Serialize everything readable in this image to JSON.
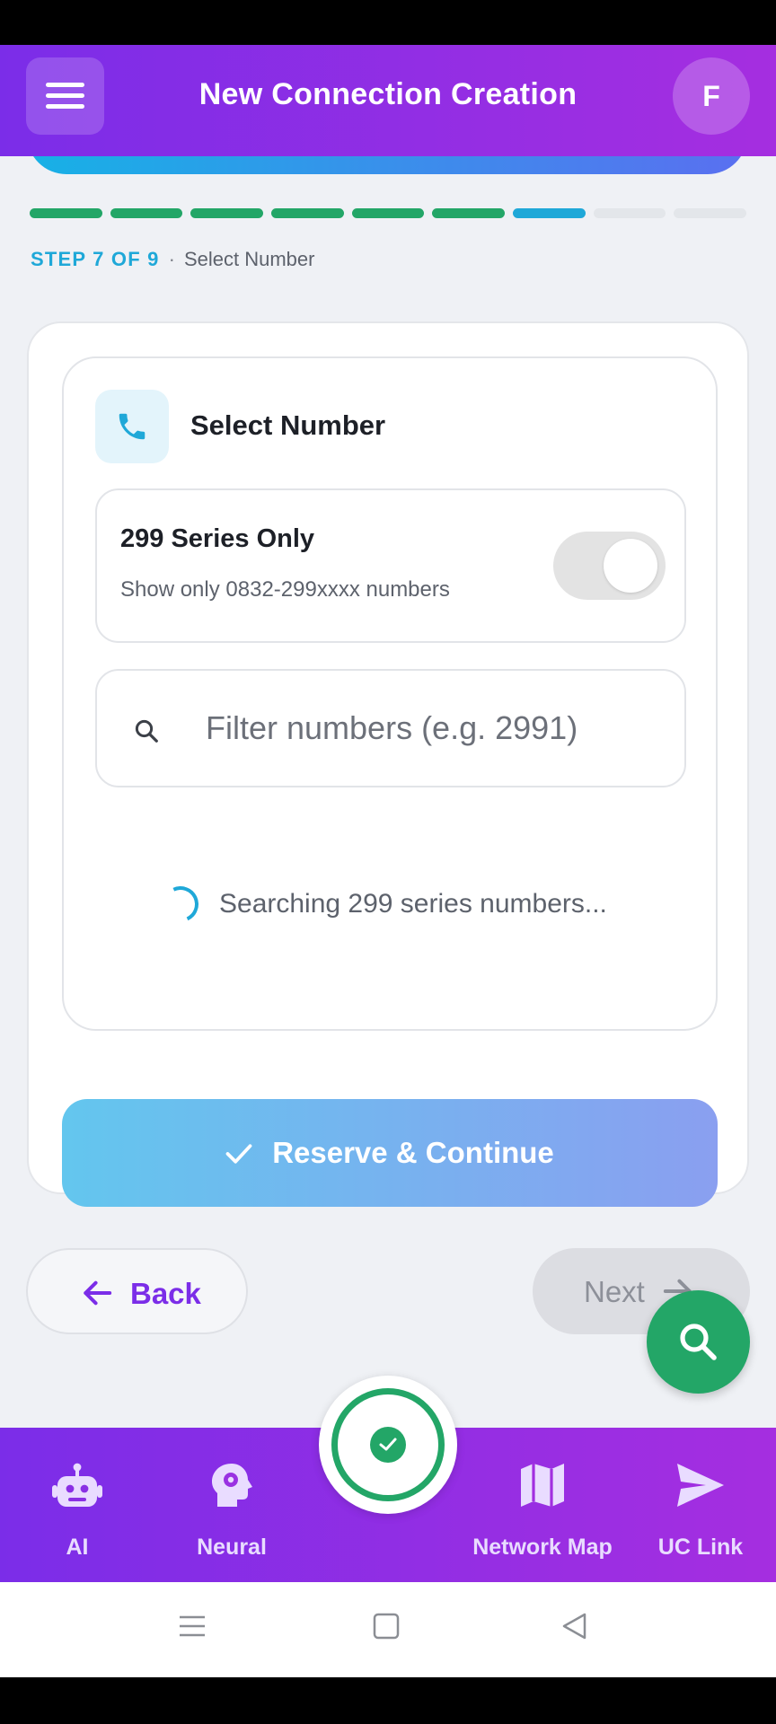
{
  "header": {
    "title": "New Connection Creation",
    "avatar_initial": "F",
    "color": "#7b2de8"
  },
  "progress": {
    "current_step": 7,
    "total_steps": 9,
    "step_label": "STEP 7 OF 9",
    "separator": "·",
    "step_name": "Select Number"
  },
  "card": {
    "title": "Select Number",
    "icon": "phone-icon",
    "toggle": {
      "title": "299 Series Only",
      "subtitle": "Show only 0832-299xxxx numbers",
      "state": "off"
    },
    "filter": {
      "placeholder": "Filter numbers (e.g. 2991)",
      "value": ""
    },
    "status_text": "Searching 299 series numbers...",
    "reserve_label": "Reserve & Continue"
  },
  "navigation": {
    "back_label": "Back",
    "next_label": "Next"
  },
  "bottom_nav": {
    "items": [
      {
        "label": "AI",
        "icon": "robot-icon"
      },
      {
        "label": "Neural",
        "icon": "brain-head-icon"
      },
      {
        "label": "",
        "icon": "check-circle-icon"
      },
      {
        "label": "Network Map",
        "icon": "map-icon"
      },
      {
        "label": "UC Link",
        "icon": "send-icon"
      }
    ]
  },
  "colors": {
    "accent_purple": "#7b2de8",
    "accent_blue": "#1fa8d8",
    "success_green": "#23a667"
  }
}
